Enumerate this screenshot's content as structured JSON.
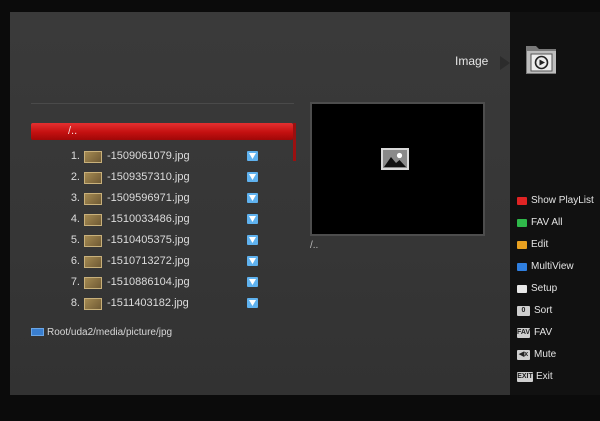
{
  "header": {
    "title": "Image"
  },
  "list": {
    "parent": "/..",
    "items": [
      {
        "num": "1.",
        "name": "-1509061079.jpg"
      },
      {
        "num": "2.",
        "name": "-1509357310.jpg"
      },
      {
        "num": "3.",
        "name": "-1509596971.jpg"
      },
      {
        "num": "4.",
        "name": "-1510033486.jpg"
      },
      {
        "num": "5.",
        "name": "-1510405375.jpg"
      },
      {
        "num": "6.",
        "name": "-1510713272.jpg"
      },
      {
        "num": "7.",
        "name": "-1510886104.jpg"
      },
      {
        "num": "8.",
        "name": "-1511403182.jpg"
      }
    ]
  },
  "path": "Root/uda2/media/picture/jpg",
  "preview": {
    "path": "/.."
  },
  "menu": {
    "show_playlist": {
      "label": "Show PlayList",
      "color": "#e02424"
    },
    "fav_all": {
      "label": "FAV All",
      "color": "#2fb84a"
    },
    "edit": {
      "label": "Edit",
      "color": "#e8a020"
    },
    "multiview": {
      "label": "MultiView",
      "color": "#2f7fe0"
    },
    "setup": {
      "label": "Setup",
      "color": "#e8e8e8"
    },
    "sort": {
      "label": "Sort",
      "key": "0"
    },
    "fav": {
      "label": "FAV",
      "key": "FAV"
    },
    "mute": {
      "label": "Mute",
      "key": "◀x"
    },
    "exit": {
      "label": "Exit",
      "key": "EXIT"
    }
  },
  "colors": {
    "highlight": "#c41010",
    "marker": "#5fb2ef",
    "background": "#363636"
  }
}
